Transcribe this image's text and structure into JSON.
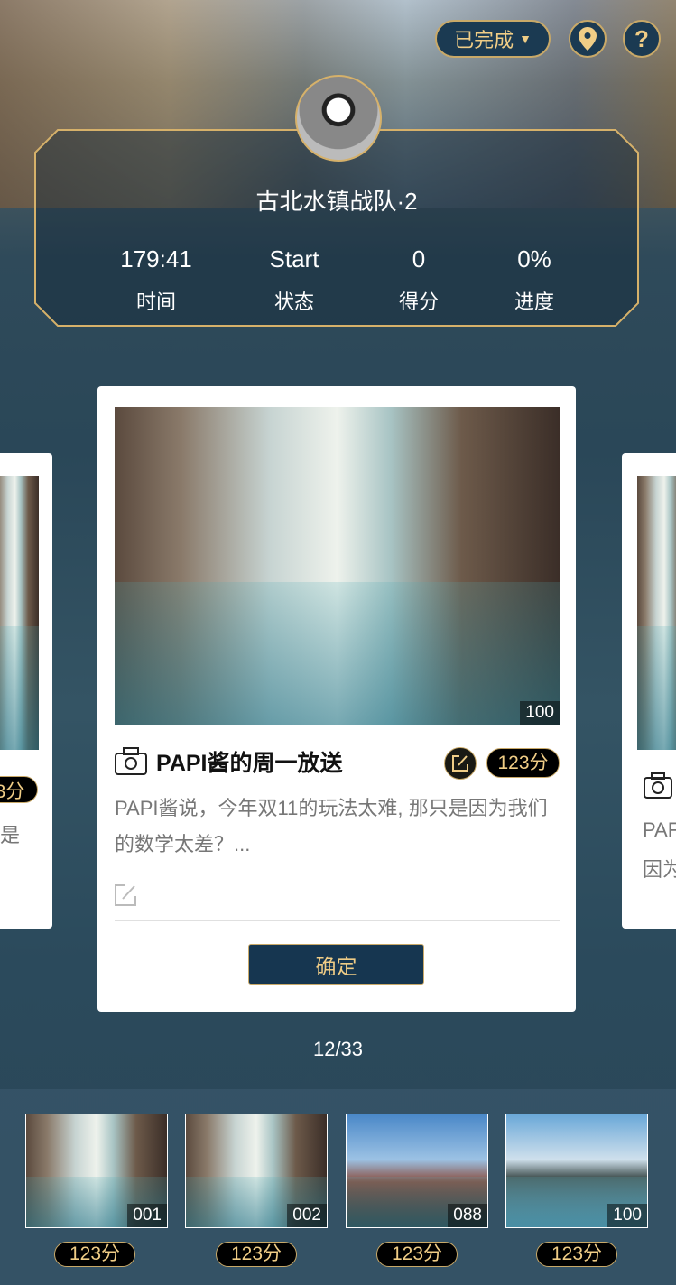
{
  "top_bar": {
    "filter_label": "已完成",
    "location_icon": "location-pin-icon",
    "help_label": "?"
  },
  "team": {
    "name": "古北水镇战队·2"
  },
  "stats": [
    {
      "value": "179:41",
      "label": "时间"
    },
    {
      "value": "Start",
      "label": "状态"
    },
    {
      "value": "0",
      "label": "得分"
    },
    {
      "value": "0%",
      "label": "进度"
    }
  ],
  "main_card": {
    "image_number": "100",
    "title": "PAPI酱的周一放送",
    "score": "123分",
    "description": "PAPI酱说，今年双11的玩法太难, 那只是因为我们的数学太差？...",
    "confirm_label": "确定"
  },
  "left_card": {
    "score_partial": "3分",
    "desc_partial": "是"
  },
  "right_card": {
    "desc_partial_1": "PAF",
    "desc_partial_2": "因为"
  },
  "pager": "12/33",
  "thumbnails": [
    {
      "number": "001",
      "score": "123分"
    },
    {
      "number": "002",
      "score": "123分"
    },
    {
      "number": "088",
      "score": "123分"
    },
    {
      "number": "100",
      "score": "123分"
    }
  ],
  "colors": {
    "gold": "#f0cd86",
    "navy": "#163650"
  }
}
